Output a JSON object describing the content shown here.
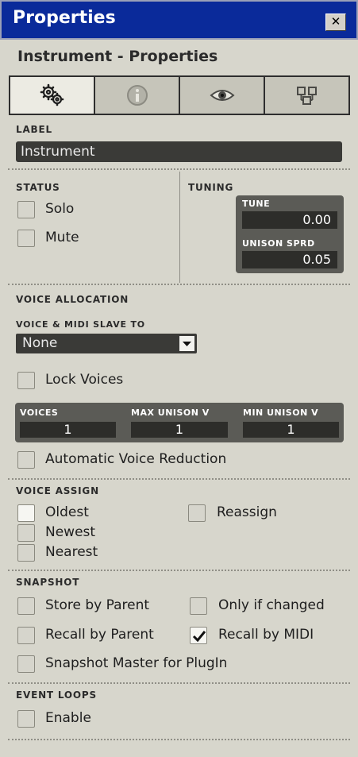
{
  "window": {
    "title": "Properties",
    "close_label": "✕"
  },
  "subtitle": "Instrument - Properties",
  "tabs": [
    {
      "name": "gears-icon",
      "active": true
    },
    {
      "name": "info-icon",
      "active": false
    },
    {
      "name": "eye-icon",
      "active": false
    },
    {
      "name": "connection-icon",
      "active": false
    }
  ],
  "label_section": {
    "heading": "LABEL",
    "value": "Instrument"
  },
  "status": {
    "heading": "STATUS",
    "solo": "Solo",
    "mute": "Mute"
  },
  "tuning": {
    "heading": "TUNING",
    "tune_label": "TUNE",
    "tune_value": "0.00",
    "unison_label": "UNISON SPRD",
    "unison_value": "0.05"
  },
  "voice_allocation": {
    "heading": "VOICE ALLOCATION",
    "slave_label": "VOICE & MIDI SLAVE TO",
    "slave_value": "None",
    "lock_voices": "Lock Voices",
    "voices_label": "VOICES",
    "voices_value": "1",
    "max_unison_label": "MAX UNISON V",
    "max_unison_value": "1",
    "min_unison_label": "MIN UNISON V",
    "min_unison_value": "1",
    "auto_reduction": "Automatic Voice Reduction"
  },
  "voice_assign": {
    "heading": "VOICE ASSIGN",
    "oldest": "Oldest",
    "newest": "Newest",
    "nearest": "Nearest",
    "reassign": "Reassign"
  },
  "snapshot": {
    "heading": "SNAPSHOT",
    "store_by_parent": "Store by Parent",
    "only_if_changed": "Only if changed",
    "recall_by_parent": "Recall by Parent",
    "recall_by_midi": "Recall by MIDI",
    "recall_by_midi_checked": true,
    "snapshot_master": "Snapshot Master for PlugIn"
  },
  "event_loops": {
    "heading": "EVENT LOOPS",
    "enable": "Enable"
  },
  "colors": {
    "titlebar": "#0a2a9a",
    "panel": "#d7d6cc",
    "field": "#3a3a37",
    "dark_panel": "#5b5b56"
  }
}
